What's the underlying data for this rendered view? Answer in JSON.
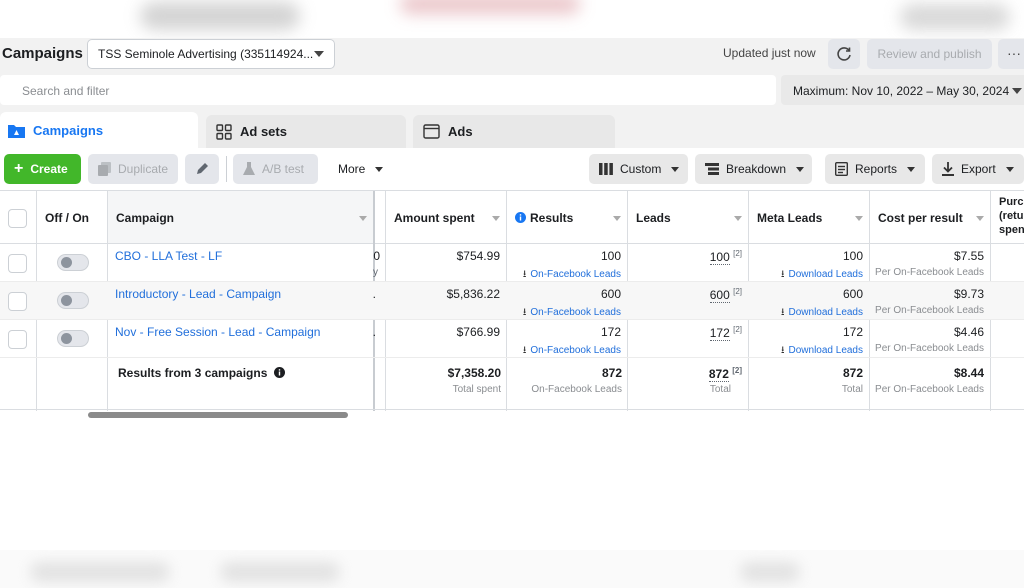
{
  "header": {
    "title": "Campaigns",
    "account": "TSS Seminole Advertising (335114924...",
    "updated": "Updated just now",
    "review_publish": "Review and publish",
    "more": "···"
  },
  "search": {
    "placeholder": "Search and filter",
    "date_range": "Maximum: Nov 10, 2022 – May 30, 2024"
  },
  "tabs": [
    {
      "label": "Campaigns",
      "active": true
    },
    {
      "label": "Ad sets",
      "active": false
    },
    {
      "label": "Ads",
      "active": false
    }
  ],
  "toolbar": {
    "create": "Create",
    "duplicate": "Duplicate",
    "ab_test": "A/B test",
    "more": "More",
    "custom": "Custom",
    "breakdown": "Breakdown",
    "reports": "Reports",
    "export": "Export"
  },
  "columns": {
    "off_on": "Off / On",
    "campaign": "Campaign",
    "amount_spent": "Amount spent",
    "results": "Results",
    "leads": "Leads",
    "meta_leads": "Meta Leads",
    "cost_per_result": "Cost per result",
    "purchase": "Purc (retu spen"
  },
  "rows": [
    {
      "campaign": "CBO - LLA Test - LF",
      "hidden_fragment": "0",
      "hidden_fragment2": "y",
      "amount_spent": "$754.99",
      "results": "100",
      "results_sub": "On-Facebook Leads",
      "leads": "100",
      "leads_sup": "[2]",
      "meta_leads": "100",
      "meta_sub": "Download Leads",
      "cost": "$7.55",
      "cost_sub": "Per On-Facebook Leads"
    },
    {
      "campaign": "Introductory - Lead - Campaign",
      "hidden_fragment": ".",
      "hidden_fragment2": "",
      "amount_spent": "$5,836.22",
      "results": "600",
      "results_sub": "On-Facebook Leads",
      "leads": "600",
      "leads_sup": "[2]",
      "meta_leads": "600",
      "meta_sub": "Download Leads",
      "cost": "$9.73",
      "cost_sub": "Per On-Facebook Leads"
    },
    {
      "campaign": "Nov - Free Session - Lead - Campaign",
      "hidden_fragment": ".",
      "hidden_fragment2": "",
      "amount_spent": "$766.99",
      "results": "172",
      "results_sub": "On-Facebook Leads",
      "leads": "172",
      "leads_sup": "[2]",
      "meta_leads": "172",
      "meta_sub": "Download Leads",
      "cost": "$4.46",
      "cost_sub": "Per On-Facebook Leads"
    }
  ],
  "summary": {
    "label": "Results from 3 campaigns",
    "amount_spent": "$7,358.20",
    "amount_sub": "Total spent",
    "results": "872",
    "results_sub": "On-Facebook Leads",
    "leads": "872",
    "leads_sup": "[2]",
    "leads_sub": "Total",
    "meta_leads": "872",
    "meta_sub": "Total",
    "cost": "$8.44",
    "cost_sub": "Per On-Facebook Leads"
  },
  "colors": {
    "brand_blue": "#1877f2",
    "link_blue": "#216fdb",
    "create_green": "#42b72a"
  }
}
